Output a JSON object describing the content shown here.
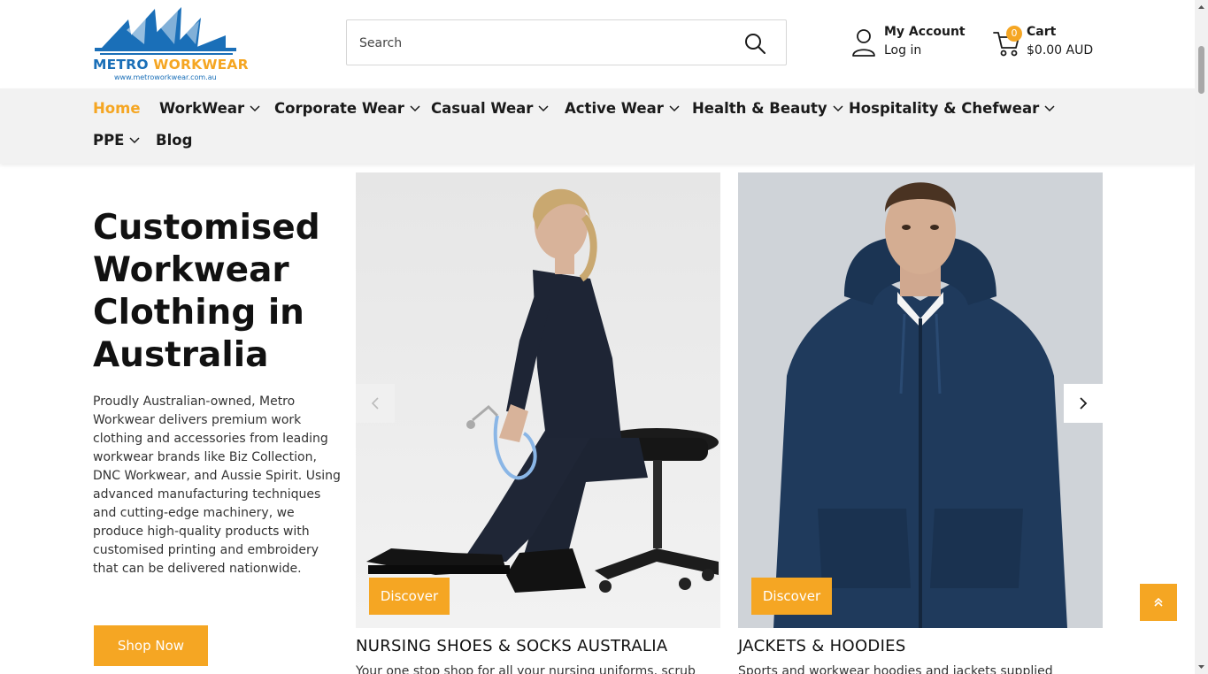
{
  "brand": {
    "name": "METRO WORKWEAR",
    "url_text": "www.metroworkwear.com.au",
    "colors": {
      "blue": "#1a6fb8",
      "orange": "#f5a623"
    }
  },
  "search": {
    "placeholder": "Search",
    "icon": "search-icon"
  },
  "account": {
    "title": "My Account",
    "subtitle": "Log in",
    "icon": "user-icon"
  },
  "cart": {
    "title": "Cart",
    "total": "$0.00 AUD",
    "count": "0",
    "icon": "cart-icon"
  },
  "nav": {
    "items": [
      {
        "label": "Home",
        "active": true,
        "dropdown": false
      },
      {
        "label": "WorkWear",
        "dropdown": true
      },
      {
        "label": "Corporate Wear",
        "dropdown": true
      },
      {
        "label": "Casual Wear",
        "dropdown": true
      },
      {
        "label": "Active Wear",
        "dropdown": true
      },
      {
        "label": "Health & Beauty",
        "dropdown": true
      },
      {
        "label": "Hospitality & Chefwear",
        "dropdown": true
      },
      {
        "label": "PPE",
        "dropdown": true
      },
      {
        "label": "Blog",
        "dropdown": false
      }
    ]
  },
  "hero": {
    "title": "Customised Workwear Clothing in Australia",
    "description": "Proudly Australian-owned, Metro Workwear delivers premium work clothing and accessories from leading workwear brands like Biz Collection, DNC Workwear, and Aussie Spirit. Using advanced manufacturing techniques and cutting-edge machinery, we produce high-quality products with customised printing and embroidery that can be delivered nationwide.",
    "cta": "Shop Now"
  },
  "cards": [
    {
      "title": "NURSING SHOES & SOCKS AUSTRALIA",
      "description": "Your one stop shop for all your nursing uniforms, scrub",
      "button": "Discover"
    },
    {
      "title": "JACKETS & HOODIES",
      "description": "Sports and workwear hoodies and jackets supplied",
      "button": "Discover"
    }
  ]
}
